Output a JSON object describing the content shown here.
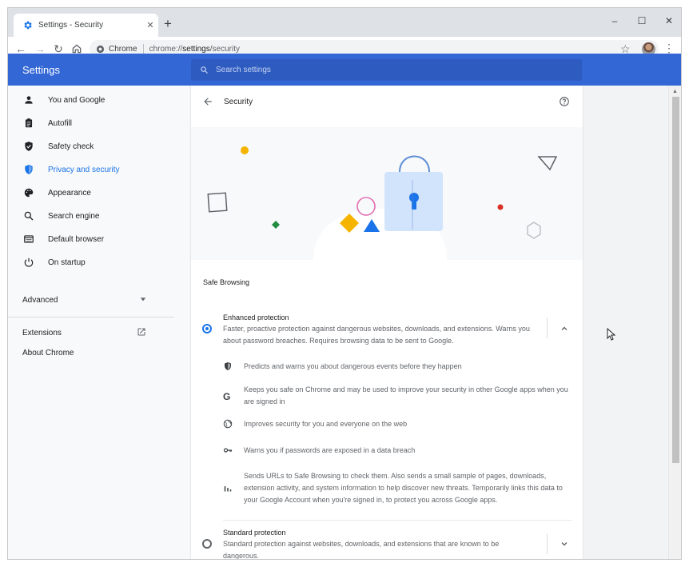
{
  "browser": {
    "tab": {
      "title": "Settings - Security",
      "icon": "gear-icon"
    },
    "new_tab_icon": "plus-icon",
    "window_controls": [
      "minimize-icon",
      "maximize-icon",
      "close-icon"
    ],
    "omnibox": {
      "chip": "Chrome",
      "url_scheme": "chrome://",
      "url_host": "settings",
      "url_path": "/security"
    }
  },
  "header": {
    "title": "Settings",
    "search_placeholder": "Search settings"
  },
  "sidebar": {
    "items": [
      {
        "label": "You and Google",
        "icon": "person-icon"
      },
      {
        "label": "Autofill",
        "icon": "clipboard-icon"
      },
      {
        "label": "Safety check",
        "icon": "shield-check-icon"
      },
      {
        "label": "Privacy and security",
        "icon": "shield-icon",
        "active": true
      },
      {
        "label": "Appearance",
        "icon": "palette-icon"
      },
      {
        "label": "Search engine",
        "icon": "search-icon"
      },
      {
        "label": "Default browser",
        "icon": "browser-icon"
      },
      {
        "label": "On startup",
        "icon": "power-icon"
      }
    ],
    "advanced": "Advanced",
    "extensions": "Extensions",
    "about": "About Chrome"
  },
  "page": {
    "title": "Security",
    "section": "Safe Browsing",
    "enhanced": {
      "title": "Enhanced protection",
      "description": "Faster, proactive protection against dangerous websites, downloads, and extensions. Warns you about password breaches. Requires browsing data to be sent to Google.",
      "selected": true,
      "features": [
        {
          "icon": "shield-icon",
          "text": "Predicts and warns you about dangerous events before they happen"
        },
        {
          "icon": "google-g-icon",
          "text": "Keeps you safe on Chrome and may be used to improve your security in other Google apps when you are signed in"
        },
        {
          "icon": "globe-icon",
          "text": "Improves security for you and everyone on the web"
        },
        {
          "icon": "key-icon",
          "text": "Warns you if passwords are exposed in a data breach"
        },
        {
          "icon": "bar-chart-icon",
          "text": "Sends URLs to Safe Browsing to check them. Also sends a small sample of pages, downloads, extension activity, and system information to help discover new threats. Temporarily links this data to your Google Account when you're signed in, to protect you across Google apps."
        }
      ]
    },
    "standard": {
      "title": "Standard protection",
      "description": "Standard protection against websites, downloads, and extensions that are known to be dangerous.",
      "selected": false
    }
  },
  "colors": {
    "header": "#3367d6",
    "accent": "#1a73e8",
    "lock_body": "#d2e3fc",
    "lock_shackle": "#5f8fd6"
  }
}
